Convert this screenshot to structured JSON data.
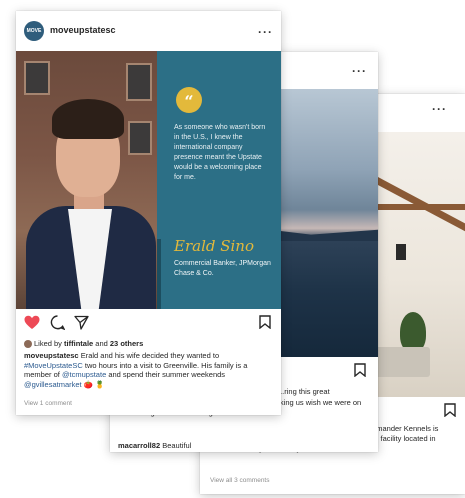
{
  "front_post": {
    "username": "moveupstatesc",
    "avatar_text": "MOVE",
    "menu": "···",
    "quote_text": "As someone who wasn't born in the U.S., I knew the international company presence meant the Upstate would be a welcoming place for me.",
    "signature": "Erald Sino",
    "signature_title": "Commercial Banker, JPMorgan Chase & Co.",
    "liked_by_prefix": "Liked by ",
    "liked_by_user": "tiffintale",
    "liked_by_suffix": " and ",
    "liked_by_others": "23 others",
    "caption_user": "moveupstatesc",
    "caption_1": " Erald and his wife decided they wanted to ",
    "caption_tag1": "#MoveUpstateSC",
    "caption_2": " two hours into a visit to Greenville. His family is a member of ",
    "caption_tag2": "@tcmupstate",
    "caption_3": " and spend their summer weekends ",
    "caption_tag3": "@gvillesatmarket",
    "caption_emoji": " 🍅 🍍",
    "comments_link": "View 1 comment"
  },
  "middle_post": {
    "menu": "···",
    "text": "shot of Devils Fork State Park with us! You're making us wish we were on the lake right now. Don't forget to...",
    "more": " more",
    "partial_line": "...ring this great",
    "comment_user": "macarroll82",
    "comment_text": " Beautiful"
  },
  "back_post": {
    "menu": "···",
    "partial_line": "...mander Kennels is",
    "text": "a family owned & operated dog boarding & training facility located in Laurens County. Owned by Laurens...",
    "more": " more",
    "comments_link": "View all 3 comments"
  },
  "icons": {
    "heart": "heart-icon",
    "comment": "comment-icon",
    "share": "share-icon",
    "bookmark": "bookmark-icon",
    "quote": "quote-icon"
  },
  "colors": {
    "quote_panel": "#2c6f86",
    "accent_gold": "#e3b93b",
    "heart_red": "#ed4956",
    "hashtag_blue": "#2b5a8f"
  }
}
